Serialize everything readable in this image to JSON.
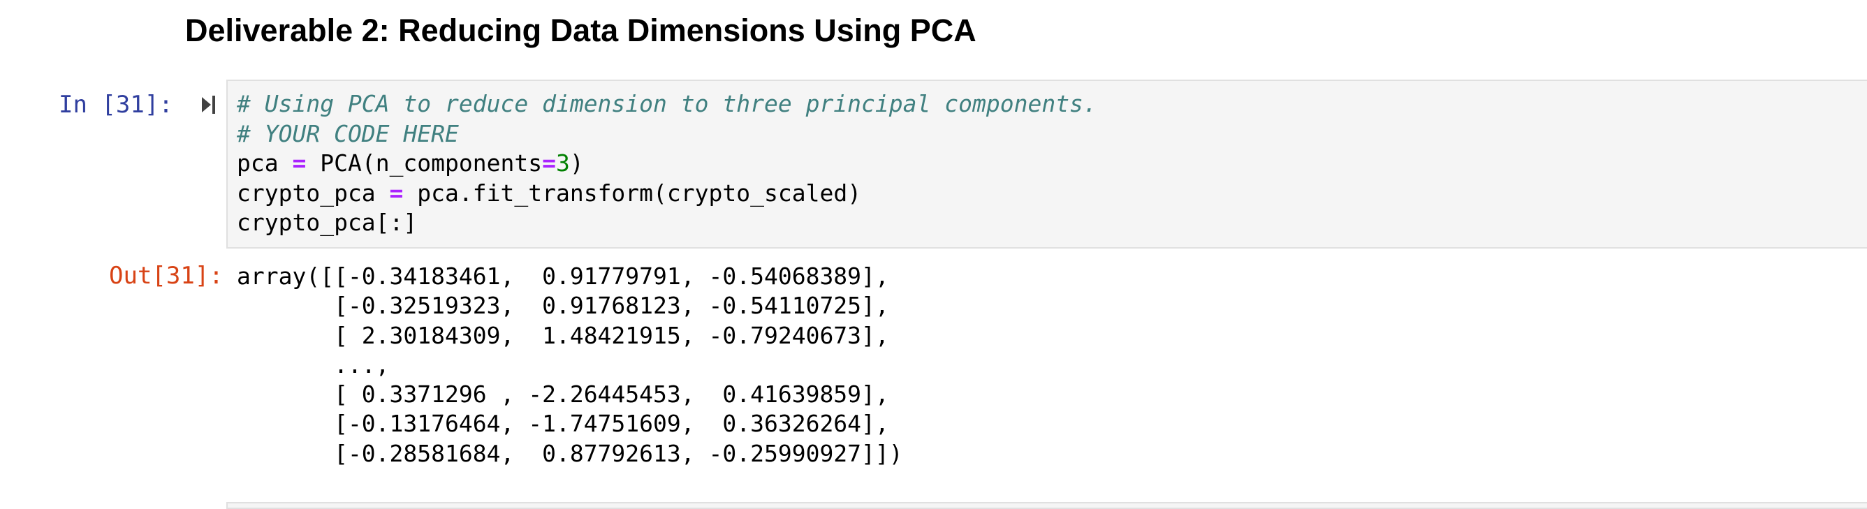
{
  "markdown_cell": {
    "heading": "Deliverable 2: Reducing Data Dimensions Using PCA"
  },
  "code_cell": {
    "input_prompt": "In [31]:",
    "run_icon": "run-cell-icon",
    "code": {
      "line1": "# Using PCA to reduce dimension to three principal components.",
      "line2": "# YOUR CODE HERE",
      "line3": {
        "before_op": "pca ",
        "op": "=",
        "middle": " PCA(n_components",
        "op2": "=",
        "num": "3",
        "after": ")"
      },
      "line4": {
        "before_op": "crypto_pca ",
        "op": "=",
        "after": " pca.fit_transform(crypto_scaled)"
      },
      "line5": "crypto_pca[:]"
    },
    "output_prompt": "Out[31]:",
    "output_lines": [
      "array([[-0.34183461,  0.91779791, -0.54068389],",
      "       [-0.32519323,  0.91768123, -0.54110725],",
      "       [ 2.30184309,  1.48421915, -0.79240673],",
      "       ...,",
      "       [ 0.3371296 , -2.26445453,  0.41639859],",
      "       [-0.13176464, -1.74751609,  0.36326264],",
      "       [-0.28581684,  0.87792613, -0.25990927]])"
    ]
  },
  "colors": {
    "input_prompt": "#303f9f",
    "output_prompt": "#d84315",
    "comment": "#408080",
    "operator": "#aa22ff",
    "number": "#008000",
    "cell_background": "#f5f5f5",
    "cell_border": "#e0e0e0"
  }
}
